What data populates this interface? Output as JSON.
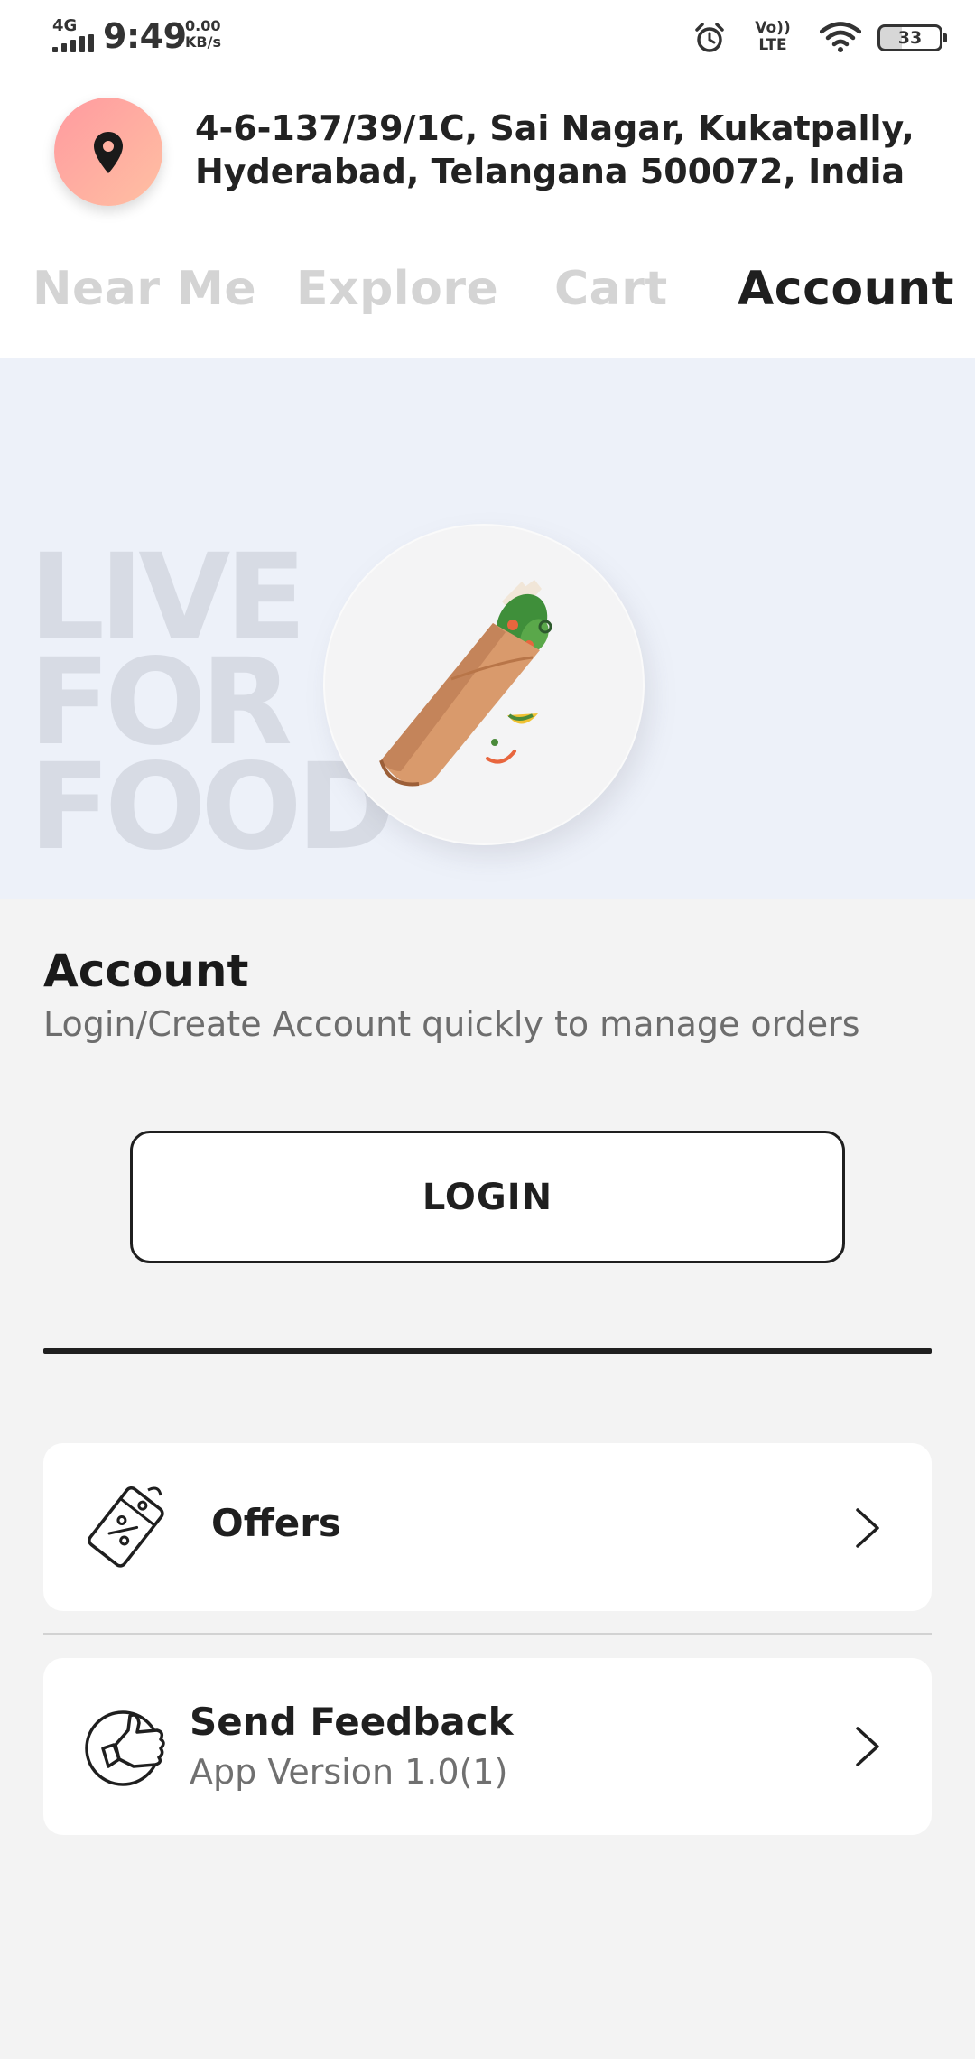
{
  "status_bar": {
    "network": "4G",
    "time": "9:49",
    "speed_value": "0.00",
    "speed_unit": "KB/s",
    "volte_top": "Vo))",
    "volte_bottom": "LTE",
    "battery": "33",
    "icons": [
      "signal-icon",
      "alarm-icon",
      "wifi-icon",
      "battery-icon"
    ]
  },
  "header": {
    "location_icon": "map-pin-icon",
    "address_line1": "4-6-137/39/1C, Sai Nagar, Kukatpally,",
    "address_line2": "Hyderabad, Telangana 500072, India"
  },
  "tabs": [
    {
      "label": "Near Me",
      "active": false
    },
    {
      "label": "Explore",
      "active": false
    },
    {
      "label": "Cart",
      "active": false
    },
    {
      "label": "Account",
      "active": true
    }
  ],
  "banner": {
    "line1": "LIVE",
    "line2": "FOR",
    "line3": "FOOD",
    "illustration": "dosa-illustration"
  },
  "account": {
    "title": "Account",
    "subtitle": "Login/Create Account quickly to manage orders",
    "login_label": "LOGIN"
  },
  "menu": {
    "offers": {
      "label": "Offers",
      "icon": "discount-tag-icon"
    },
    "feedback": {
      "label": "Send Feedback",
      "subtext": "App Version 1.0(1)",
      "icon": "thumbs-up-icon"
    }
  },
  "colors": {
    "background": "#f3f3f3",
    "banner_bg": "#edf1f9",
    "active_tab": "#1f1f1f",
    "inactive_tab": "#d4d4d4",
    "location_badge": "#ffaaa1"
  }
}
